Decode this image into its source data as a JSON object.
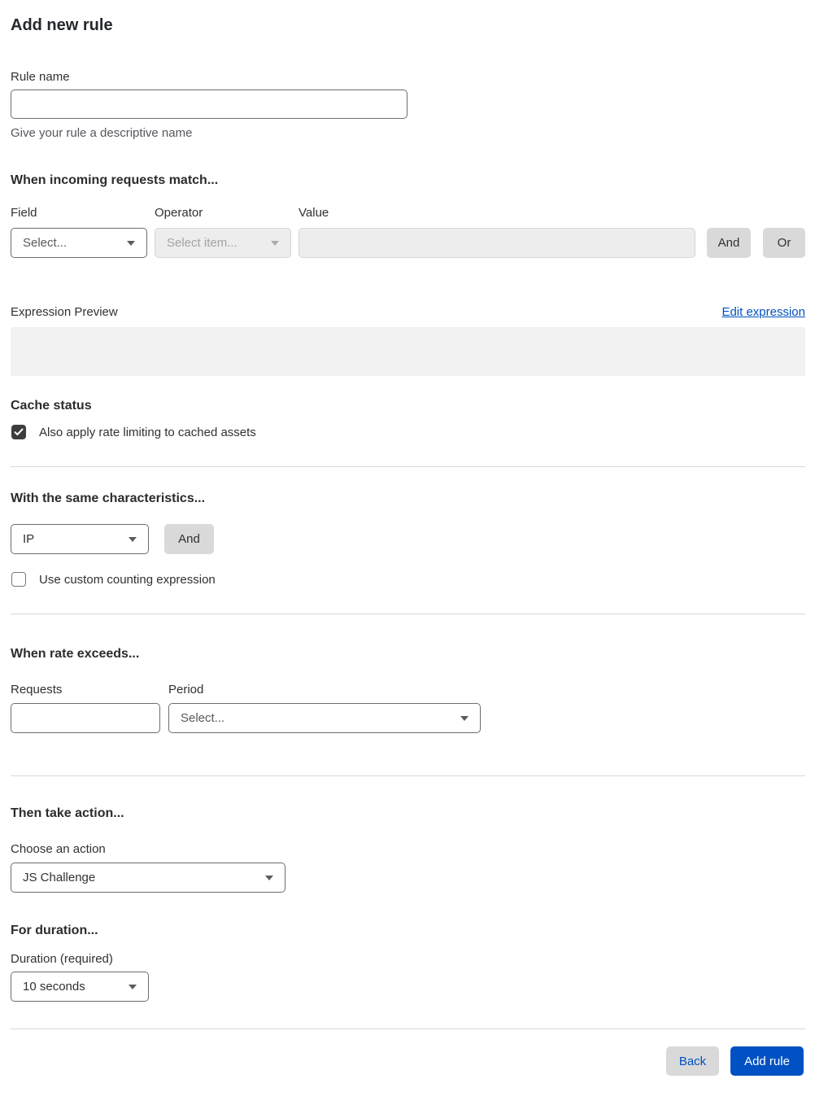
{
  "page": {
    "title": "Add new rule"
  },
  "rule_name": {
    "label": "Rule name",
    "value": "",
    "helper": "Give your rule a descriptive name"
  },
  "match": {
    "heading": "When incoming requests match...",
    "field": {
      "label": "Field",
      "selected": "Select..."
    },
    "operator": {
      "label": "Operator",
      "selected": "Select item...",
      "disabled": true
    },
    "value": {
      "label": "Value",
      "value": "",
      "disabled": true
    },
    "and_button": "And",
    "or_button": "Or"
  },
  "expression": {
    "label": "Expression Preview",
    "edit_link": "Edit expression",
    "preview_value": ""
  },
  "cache": {
    "heading": "Cache status",
    "checkbox_label": "Also apply rate limiting to cached assets",
    "checked": true
  },
  "characteristics": {
    "heading": "With the same characteristics...",
    "selected": "IP",
    "and_button": "And",
    "checkbox_label": "Use custom counting expression",
    "checked": false
  },
  "rate": {
    "heading": "When rate exceeds...",
    "requests": {
      "label": "Requests",
      "value": ""
    },
    "period": {
      "label": "Period",
      "selected": "Select..."
    }
  },
  "action": {
    "heading": "Then take action...",
    "label": "Choose an action",
    "selected": "JS Challenge"
  },
  "duration": {
    "heading": "For duration...",
    "label": "Duration (required)",
    "selected": "10 seconds"
  },
  "footer": {
    "back_button": "Back",
    "submit_button": "Add rule"
  },
  "colors": {
    "accent_blue": "#0051c3",
    "checkbox_checked": "#3d3d3d",
    "button_gray": "#d9d9d9",
    "divider": "#d9d9d9",
    "preview_bg": "#f2f2f2"
  }
}
